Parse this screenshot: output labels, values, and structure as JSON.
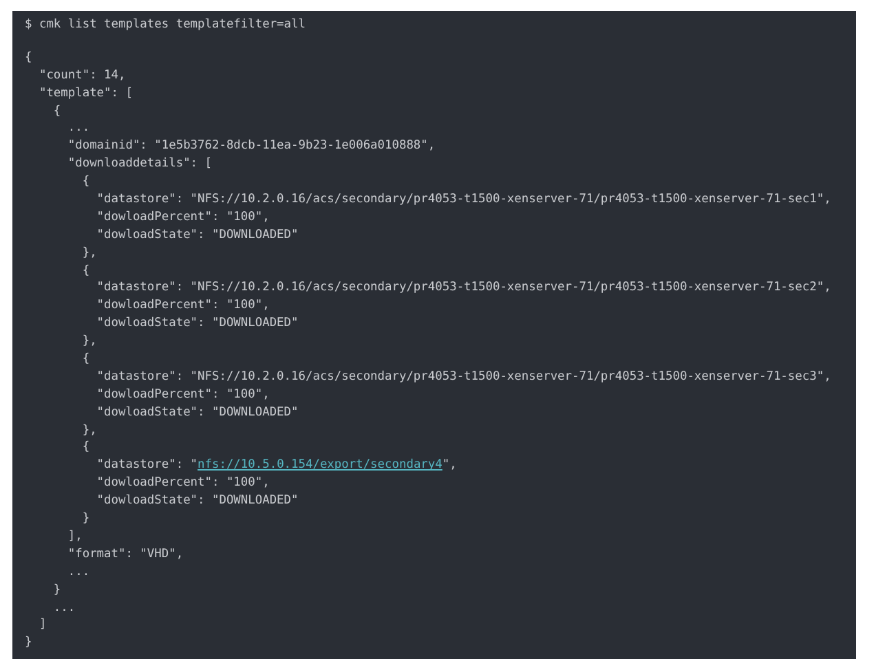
{
  "terminal": {
    "command": "$ cmk list templates templatefilter=all",
    "lines": [
      {
        "kind": "text",
        "text": "{"
      },
      {
        "kind": "text",
        "text": "  \"count\": 14,"
      },
      {
        "kind": "text",
        "text": "  \"template\": ["
      },
      {
        "kind": "text",
        "text": "    {"
      },
      {
        "kind": "text",
        "text": "      ..."
      },
      {
        "kind": "text",
        "text": "      \"domainid\": \"1e5b3762-8dcb-11ea-9b23-1e006a010888\","
      },
      {
        "kind": "text",
        "text": "      \"downloaddetails\": ["
      },
      {
        "kind": "text",
        "text": "        {"
      },
      {
        "kind": "text",
        "text": "          \"datastore\": \"NFS://10.2.0.16/acs/secondary/pr4053-t1500-xenserver-71/pr4053-t1500-xenserver-71-sec1\","
      },
      {
        "kind": "text",
        "text": "          \"dowloadPercent\": \"100\","
      },
      {
        "kind": "text",
        "text": "          \"dowloadState\": \"DOWNLOADED\""
      },
      {
        "kind": "text",
        "text": "        },"
      },
      {
        "kind": "text",
        "text": "        {"
      },
      {
        "kind": "text",
        "text": "          \"datastore\": \"NFS://10.2.0.16/acs/secondary/pr4053-t1500-xenserver-71/pr4053-t1500-xenserver-71-sec2\","
      },
      {
        "kind": "text",
        "text": "          \"dowloadPercent\": \"100\","
      },
      {
        "kind": "text",
        "text": "          \"dowloadState\": \"DOWNLOADED\""
      },
      {
        "kind": "text",
        "text": "        },"
      },
      {
        "kind": "text",
        "text": "        {"
      },
      {
        "kind": "text",
        "text": "          \"datastore\": \"NFS://10.2.0.16/acs/secondary/pr4053-t1500-xenserver-71/pr4053-t1500-xenserver-71-sec3\","
      },
      {
        "kind": "text",
        "text": "          \"dowloadPercent\": \"100\","
      },
      {
        "kind": "text",
        "text": "          \"dowloadState\": \"DOWNLOADED\""
      },
      {
        "kind": "text",
        "text": "        },"
      },
      {
        "kind": "text",
        "text": "        {"
      },
      {
        "kind": "link",
        "before": "          \"datastore\": \"",
        "link": "nfs://10.5.0.154/export/secondary4",
        "after": "\","
      },
      {
        "kind": "text",
        "text": "          \"dowloadPercent\": \"100\","
      },
      {
        "kind": "text",
        "text": "          \"dowloadState\": \"DOWNLOADED\""
      },
      {
        "kind": "text",
        "text": "        }"
      },
      {
        "kind": "text",
        "text": "      ],"
      },
      {
        "kind": "text",
        "text": "      \"format\": \"VHD\","
      },
      {
        "kind": "text",
        "text": "      ..."
      },
      {
        "kind": "text",
        "text": "    }"
      },
      {
        "kind": "text",
        "text": "    ..."
      },
      {
        "kind": "text",
        "text": "  ]"
      },
      {
        "kind": "text",
        "text": "}"
      }
    ]
  }
}
